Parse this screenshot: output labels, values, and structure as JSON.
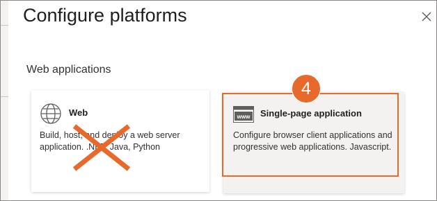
{
  "dialog": {
    "title": "Configure platforms",
    "close_icon": "close-icon"
  },
  "section": {
    "heading": "Web applications"
  },
  "platforms": [
    {
      "icon": "globe-icon",
      "title": "Web",
      "description": "Build, host, and deploy a web server application. .NET, Java, Python",
      "status_mark": "x-mark",
      "mark_color": "#e8692c"
    },
    {
      "icon": "www-icon",
      "title": "Single-page application",
      "description": "Configure browser client applications and progressive web applications. Javascript.",
      "highlighted": true,
      "step_number": "4",
      "highlight_color": "#e8692c"
    }
  ]
}
